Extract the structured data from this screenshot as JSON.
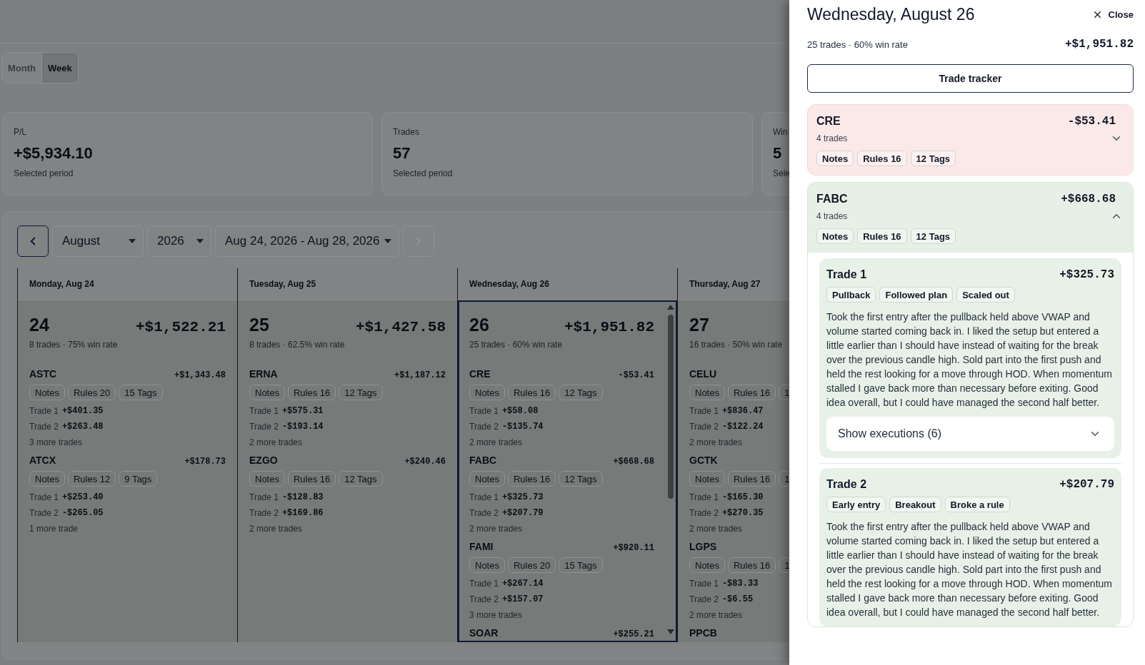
{
  "view_toggle": [
    {
      "label": "Month",
      "selected": false
    },
    {
      "label": "Week",
      "selected": true
    }
  ],
  "stats": [
    {
      "label": "P/L",
      "value": "+$5,934.10",
      "caption": "Selected period"
    },
    {
      "label": "Trades",
      "value": "57",
      "caption": "Selected period"
    },
    {
      "label": "Win",
      "value": "5",
      "caption": "Sele"
    }
  ],
  "calendar": {
    "month": "August",
    "year": "2026",
    "range": "Aug 24, 2026 - Aug 28, 2026",
    "days": [
      {
        "header": "Monday, Aug 24",
        "date": "24",
        "pnl": "+$1,522.21",
        "summary": "8 trades · 75% win rate",
        "selected": false,
        "tickers": [
          {
            "symbol": "ASTC",
            "pnl": "+$1,343.48",
            "chips": [
              "Notes",
              "Rules 20",
              "15 Tags"
            ],
            "trades": [
              {
                "label": "Trade 1",
                "pnl": "+$401.35"
              },
              {
                "label": "Trade 2",
                "pnl": "+$263.48"
              }
            ],
            "more": "3 more trades"
          },
          {
            "symbol": "ATCX",
            "pnl": "+$178.73",
            "chips": [
              "Notes",
              "Rules 12",
              "9 Tags"
            ],
            "trades": [
              {
                "label": "Trade 1",
                "pnl": "+$253.40"
              },
              {
                "label": "Trade 2",
                "pnl": "-$265.05"
              }
            ],
            "more": "1 more trade"
          }
        ]
      },
      {
        "header": "Tuesday, Aug 25",
        "date": "25",
        "pnl": "+$1,427.58",
        "summary": "8 trades · 62.5% win rate",
        "selected": false,
        "tickers": [
          {
            "symbol": "ERNA",
            "pnl": "+$1,187.12",
            "chips": [
              "Notes",
              "Rules 16",
              "12 Tags"
            ],
            "trades": [
              {
                "label": "Trade 1",
                "pnl": "+$575.31"
              },
              {
                "label": "Trade 2",
                "pnl": "-$193.14"
              }
            ],
            "more": "2 more trades"
          },
          {
            "symbol": "EZGO",
            "pnl": "+$240.46",
            "chips": [
              "Notes",
              "Rules 16",
              "12 Tags"
            ],
            "trades": [
              {
                "label": "Trade 1",
                "pnl": "-$128.83"
              },
              {
                "label": "Trade 2",
                "pnl": "+$169.86"
              }
            ],
            "more": "2 more trades"
          }
        ]
      },
      {
        "header": "Wednesday, Aug 26",
        "date": "26",
        "pnl": "+$1,951.82",
        "summary": "25 trades · 60% win rate",
        "selected": true,
        "tickers": [
          {
            "symbol": "CRE",
            "pnl": "-$53.41",
            "chips": [
              "Notes",
              "Rules 16",
              "12 Tags"
            ],
            "trades": [
              {
                "label": "Trade 1",
                "pnl": "+$58.08"
              },
              {
                "label": "Trade 2",
                "pnl": "-$135.74"
              }
            ],
            "more": "2 more trades"
          },
          {
            "symbol": "FABC",
            "pnl": "+$668.68",
            "chips": [
              "Notes",
              "Rules 16",
              "12 Tags"
            ],
            "trades": [
              {
                "label": "Trade 1",
                "pnl": "+$325.73"
              },
              {
                "label": "Trade 2",
                "pnl": "+$207.79"
              }
            ],
            "more": "2 more trades"
          },
          {
            "symbol": "FAMI",
            "pnl": "+$920.11",
            "chips": [
              "Notes",
              "Rules 20",
              "15 Tags"
            ],
            "trades": [
              {
                "label": "Trade 1",
                "pnl": "+$267.14"
              },
              {
                "label": "Trade 2",
                "pnl": "+$157.07"
              }
            ],
            "more": "3 more trades"
          },
          {
            "symbol": "SOAR",
            "pnl": "+$255.21"
          }
        ]
      },
      {
        "header": "Thursday, Aug 27",
        "date": "27",
        "summary": "16 trades · 50% win rate",
        "selected": false,
        "tickers": [
          {
            "symbol": "CELU",
            "chips": [
              "Notes",
              "Rules 16",
              "1"
            ],
            "trades": [
              {
                "label": "Trade 1",
                "pnl": "+$836.47"
              },
              {
                "label": "Trade 2",
                "pnl": "-$122.24"
              }
            ],
            "more": "2 more trades"
          },
          {
            "symbol": "GCTK",
            "chips": [
              "Notes",
              "Rules 16",
              "1"
            ],
            "trades": [
              {
                "label": "Trade 1",
                "pnl": "-$165.30"
              },
              {
                "label": "Trade 2",
                "pnl": "+$270.35"
              }
            ],
            "more": "2 more trades"
          },
          {
            "symbol": "LGPS",
            "chips": [
              "Notes",
              "Rules 16",
              "1"
            ],
            "trades": [
              {
                "label": "Trade 1",
                "pnl": "-$83.33"
              },
              {
                "label": "Trade 2",
                "pnl": "-$6.55"
              }
            ],
            "more": "2 more trades"
          },
          {
            "symbol": "PPCB"
          }
        ]
      }
    ]
  },
  "drawer": {
    "title": "Wednesday, August 26",
    "close": "Close",
    "summary": "25 trades · 60% win rate",
    "pnl": "+$1,951.82",
    "tracker_button": "Trade tracker",
    "tickers": [
      {
        "symbol": "CRE",
        "pnl": "-$53.41",
        "count": "4 trades",
        "kind": "loss",
        "expanded": false,
        "chips": [
          "Notes",
          "Rules 16",
          "12 Tags"
        ]
      },
      {
        "symbol": "FABC",
        "pnl": "+$668.68",
        "count": "4 trades",
        "kind": "win",
        "expanded": true,
        "chips": [
          "Notes",
          "Rules 16",
          "12 Tags"
        ],
        "trades": [
          {
            "title": "Trade 1",
            "pnl": "+$325.73",
            "tags": [
              "Pullback",
              "Followed plan",
              "Scaled out"
            ],
            "note": "Took the first entry after the pullback held above VWAP and volume started coming back in. I liked the setup but entered a little earlier than I should have instead of waiting for the break over the previous candle high. Sold part into the first push and held the rest looking for a move through HOD. When momentum stalled I gave back more than necessary before exiting. Good idea overall, but I could have managed the second half better.",
            "executions": "Show executions (6)"
          },
          {
            "title": "Trade 2",
            "pnl": "+$207.79",
            "tags": [
              "Early entry",
              "Breakout",
              "Broke a rule"
            ],
            "note": "Took the first entry after the pullback held above VWAP and volume started coming back in. I liked the setup but entered a little earlier than I should have instead of waiting for the break over the previous candle high. Sold part into the first push and held the rest looking for a move through HOD. When momentum stalled I gave back more than necessary before exiting. Good idea overall, but I could have managed the second half better."
          }
        ]
      }
    ]
  }
}
